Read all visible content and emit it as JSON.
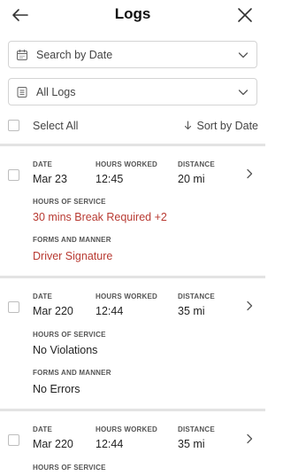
{
  "header": {
    "title": "Logs"
  },
  "filters": {
    "date_placeholder": "Search by Date",
    "log_type": "All Logs"
  },
  "toolbar": {
    "select_all": "Select All",
    "sort": "Sort by Date"
  },
  "field_labels": {
    "date": "DATE",
    "hours_worked": "HOURS WORKED",
    "distance": "DISTANCE",
    "hours_of_service": "HOURS OF SERVICE",
    "forms_and_manner": "FORMS AND MANNER"
  },
  "logs": [
    {
      "date": "Mar 23",
      "hours_worked": "12:45",
      "distance": "20 mi",
      "hours_of_service": "30 mins Break Required +2",
      "forms_and_manner": "Driver Signature"
    },
    {
      "date": "Mar 220",
      "hours_worked": "12:44",
      "distance": "35 mi",
      "hours_of_service": "No Violations",
      "forms_and_manner": "No Errors"
    },
    {
      "date": "Mar 220",
      "hours_worked": "12:44",
      "distance": "35 mi"
    }
  ],
  "colors": {
    "alert": "#b83a32",
    "divider": "#e3e3e3",
    "border": "#d4d4d4"
  }
}
